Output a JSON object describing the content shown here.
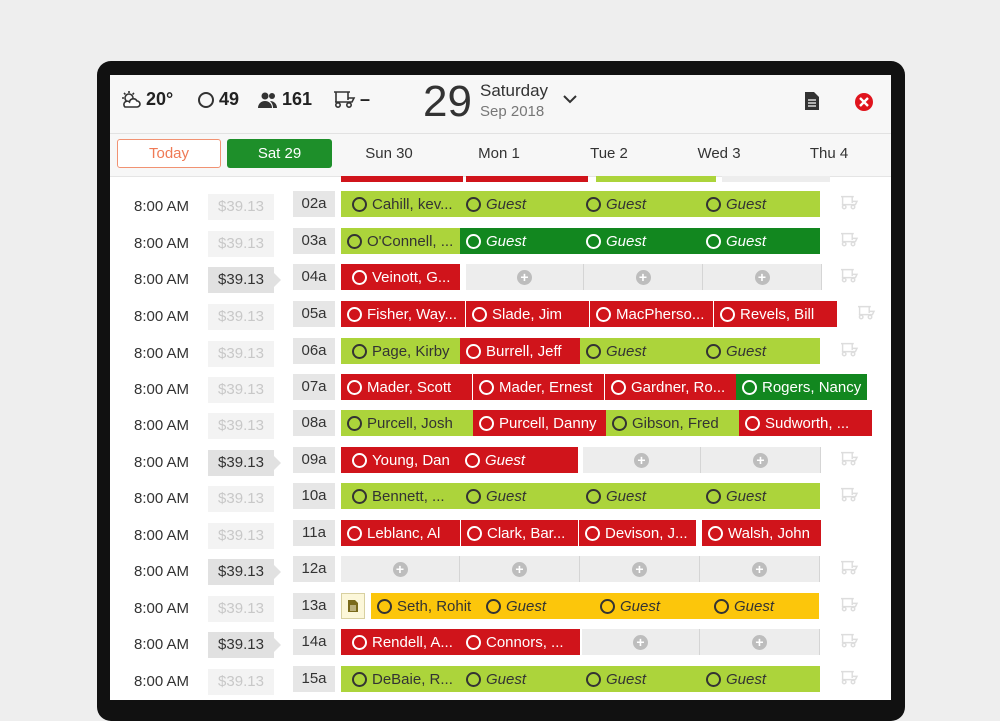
{
  "header": {
    "weather_temp": "20°",
    "players_count": "49",
    "members_count": "161",
    "carts_value": "–",
    "date_number": "29",
    "date_weekday": "Saturday",
    "date_month": "Sep 2018"
  },
  "day_nav": {
    "today_label": "Today",
    "days": [
      "Sat 29",
      "Sun 30",
      "Mon 1",
      "Tue 2",
      "Wed 3",
      "Thu 4"
    ]
  },
  "colors": {
    "red": "#d0141b",
    "green": "#12871f",
    "lime": "#acd43b",
    "yellow": "#fcc60b",
    "empty": "#ededed",
    "today_accent": "#ef7a55"
  },
  "tee_sheet": [
    {
      "time": "8:00 AM",
      "price": "$39.13",
      "hole": "02a"
    },
    {
      "time": "8:00 AM",
      "price": "$39.13",
      "hole": "03a"
    },
    {
      "time": "8:00 AM",
      "price": "$39.13",
      "hole": "04a"
    },
    {
      "time": "8:00 AM",
      "price": "$39.13",
      "hole": "05a"
    },
    {
      "time": "8:00 AM",
      "price": "$39.13",
      "hole": "06a"
    },
    {
      "time": "8:00 AM",
      "price": "$39.13",
      "hole": "07a"
    },
    {
      "time": "8:00 AM",
      "price": "$39.13",
      "hole": "08a"
    },
    {
      "time": "8:00 AM",
      "price": "$39.13",
      "hole": "09a"
    },
    {
      "time": "8:00 AM",
      "price": "$39.13",
      "hole": "10a"
    },
    {
      "time": "8:00 AM",
      "price": "$39.13",
      "hole": "11a"
    },
    {
      "time": "8:00 AM",
      "price": "$39.13",
      "hole": "12a"
    },
    {
      "time": "8:00 AM",
      "price": "$39.13",
      "hole": "13a"
    },
    {
      "time": "8:00 AM",
      "price": "$39.13",
      "hole": "14a"
    },
    {
      "time": "8:00 AM",
      "price": "$39.13",
      "hole": "15a"
    }
  ],
  "slots": {
    "r0": [
      "Cahill, kev...",
      "Guest",
      "Guest",
      "Guest"
    ],
    "r1": [
      "O'Connell, ...",
      "Guest",
      "Guest",
      "Guest"
    ],
    "r2": [
      "Veinott, G..."
    ],
    "r3": [
      "Fisher, Way...",
      "Slade, Jim",
      "MacPherso...",
      "Revels, Bill"
    ],
    "r4": [
      "Page, Kirby",
      "Burrell, Jeff",
      "Guest",
      "Guest"
    ],
    "r5": [
      "Mader, Scott",
      "Mader, Ernest",
      "Gardner, Ro...",
      "Rogers, Nancy"
    ],
    "r6": [
      "Purcell, Josh",
      "Purcell, Danny",
      "Gibson, Fred",
      "Sudworth, ..."
    ],
    "r7": [
      "Young, Dan",
      "Guest"
    ],
    "r8": [
      "Bennett, ...",
      "Guest",
      "Guest",
      "Guest"
    ],
    "r9": [
      "Leblanc, Al",
      "Clark, Bar...",
      "Devison, J...",
      "Walsh, John"
    ],
    "r11": [
      "Seth, Rohit",
      "Guest",
      "Guest",
      "Guest"
    ],
    "r12": [
      "Rendell, A...",
      "Connors, ..."
    ],
    "r13": [
      "DeBaie, R...",
      "Guest",
      "Guest",
      "Guest"
    ]
  }
}
